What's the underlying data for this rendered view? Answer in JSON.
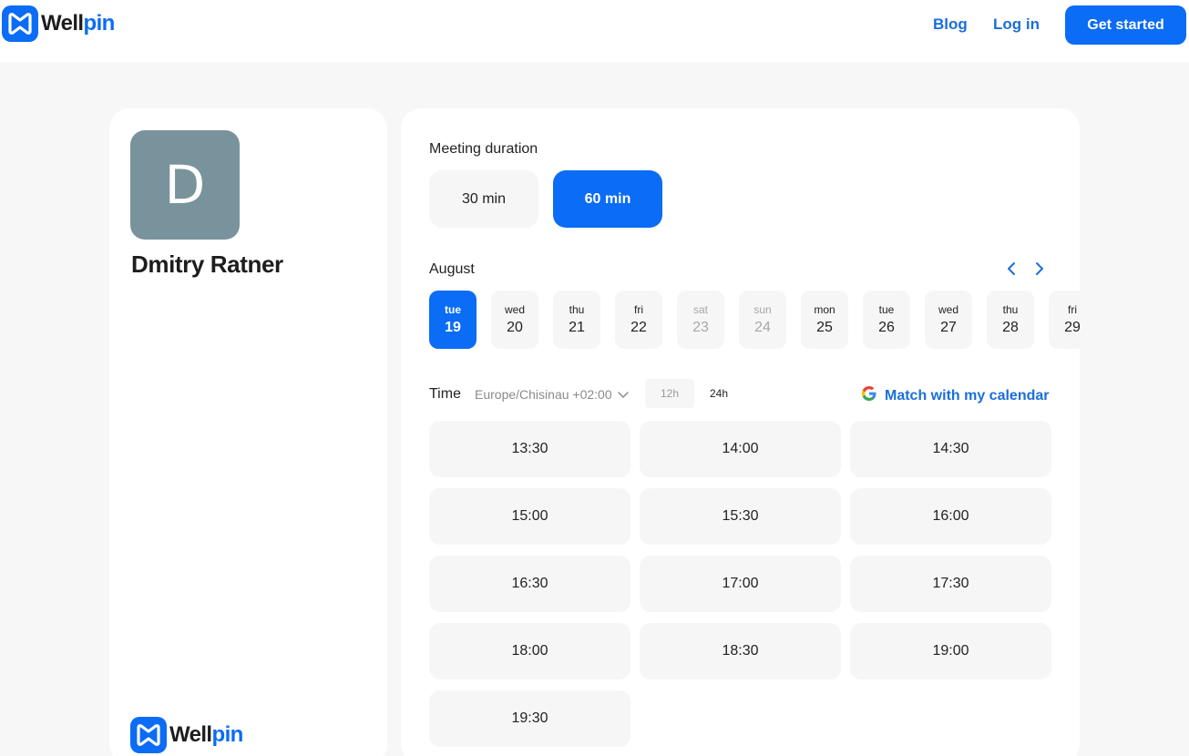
{
  "brand": {
    "name_dark": "Well",
    "name_blue": "pin"
  },
  "nav": {
    "blog": "Blog",
    "login": "Log in",
    "cta": "Get started"
  },
  "host": {
    "initial": "D",
    "name": "Dmitry Ratner"
  },
  "duration": {
    "label": "Meeting duration",
    "options": [
      "30 min",
      "60 min"
    ],
    "selected": "60 min"
  },
  "calendar": {
    "month": "August",
    "days": [
      {
        "dn": "tue",
        "dd": "19",
        "state": "selected"
      },
      {
        "dn": "wed",
        "dd": "20",
        "state": "normal"
      },
      {
        "dn": "thu",
        "dd": "21",
        "state": "normal"
      },
      {
        "dn": "fri",
        "dd": "22",
        "state": "normal"
      },
      {
        "dn": "sat",
        "dd": "23",
        "state": "weekend"
      },
      {
        "dn": "sun",
        "dd": "24",
        "state": "weekend"
      },
      {
        "dn": "mon",
        "dd": "25",
        "state": "normal"
      },
      {
        "dn": "tue",
        "dd": "26",
        "state": "normal"
      },
      {
        "dn": "wed",
        "dd": "27",
        "state": "normal"
      },
      {
        "dn": "thu",
        "dd": "28",
        "state": "normal"
      },
      {
        "dn": "fri",
        "dd": "29",
        "state": "normal"
      }
    ]
  },
  "time": {
    "label": "Time",
    "timezone": "Europe/Chisinau +02:00",
    "format_12": "12h",
    "format_24": "24h",
    "selected_format": "24h",
    "match_calendar": "Match with my calendar",
    "slots": [
      "13:30",
      "14:00",
      "14:30",
      "15:00",
      "15:30",
      "16:00",
      "16:30",
      "17:00",
      "17:30",
      "18:00",
      "18:30",
      "19:00",
      "19:30"
    ]
  },
  "colors": {
    "accent": "#0b6cf5",
    "link": "#1a6fd9",
    "avatar": "#79939c",
    "surface": "#f6f6f6",
    "page": "#f7f7f7"
  }
}
